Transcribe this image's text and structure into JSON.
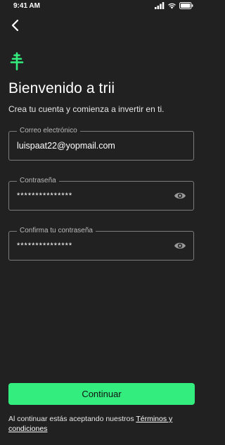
{
  "status_bar": {
    "time": "9:41 AM"
  },
  "header": {
    "title": "Bienvenido a trii",
    "subtitle": "Crea tu cuenta y comienza a invertir en ti."
  },
  "form": {
    "email": {
      "label": "Correo electrónico",
      "value": "luispaat22@yopmail.com"
    },
    "password": {
      "label": "Contraseña",
      "value": "***************"
    },
    "confirm_password": {
      "label": "Confirma tu contraseña",
      "value": "***************"
    }
  },
  "footer": {
    "continue_label": "Continuar",
    "terms_prefix": "Al continuar estás aceptando nuestros ",
    "terms_link": "Términos y condiciones"
  },
  "colors": {
    "background": "#212121",
    "accent": "#33ee7f",
    "field_border": "#7c7c7c"
  },
  "icons": [
    "back-arrow-icon",
    "tree-logo-icon",
    "eye-icon",
    "signal-icon",
    "wifi-icon",
    "battery-icon"
  ]
}
